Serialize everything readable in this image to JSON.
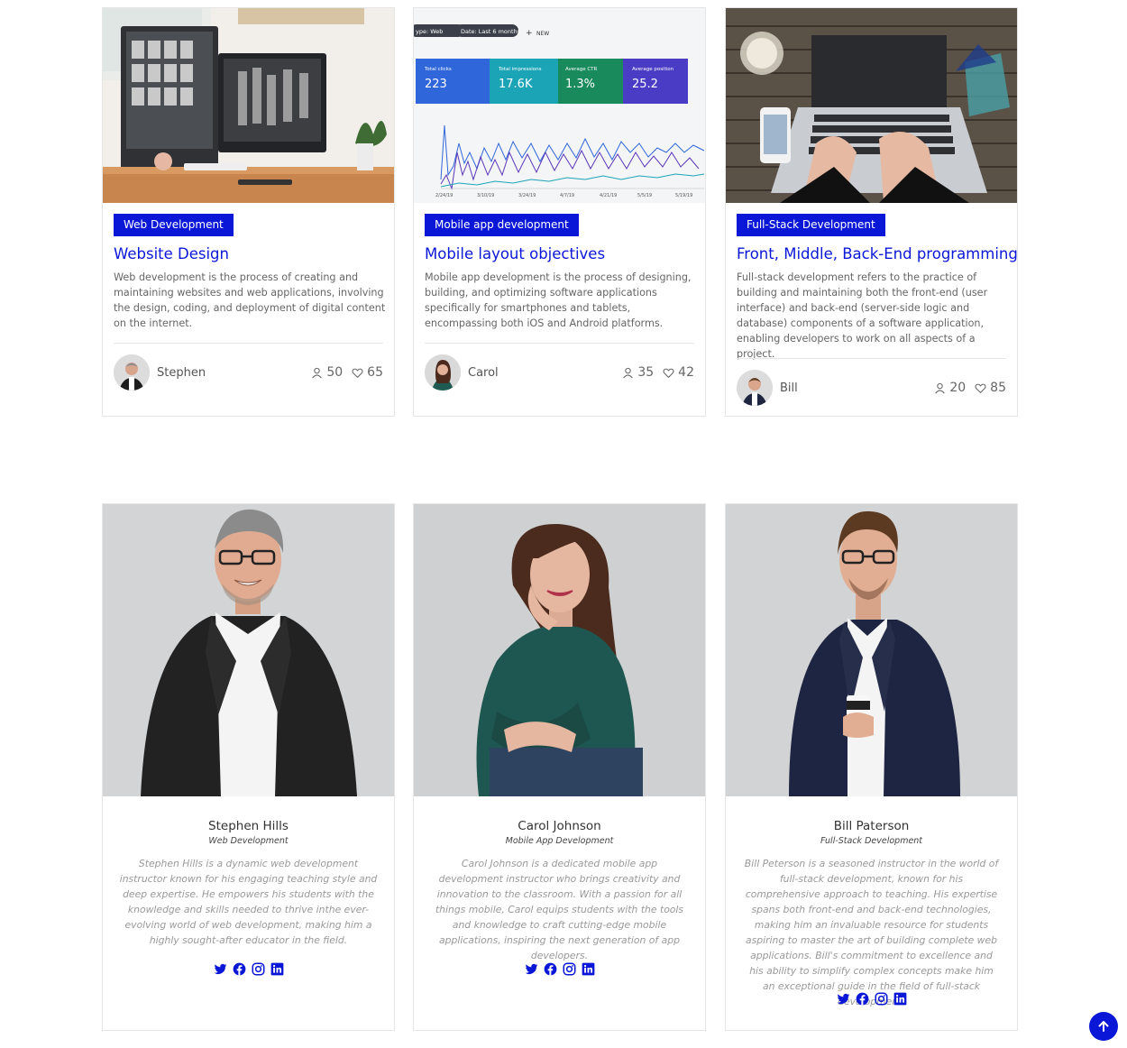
{
  "courses": [
    {
      "category": "Web Development",
      "title": "Website Design",
      "description": "Web development is the process of creating and maintaining websites and web applications, involving the design, coding, and deployment of digital content on the internet.",
      "author": "Stephen",
      "students": "50",
      "likes": "65",
      "image_icon": "desk-computers-photo"
    },
    {
      "category": "Mobile app development",
      "title": "Mobile layout objectives",
      "description": "Mobile app development is the process of designing, building, and optimizing software applications specifically for smartphones and tablets, encompassing both iOS and Android platforms.",
      "author": "Carol",
      "students": "35",
      "likes": "42",
      "image_icon": "analytics-dashboard-photo",
      "dashboard": {
        "chips": [
          "ype: Web",
          "Date: Last 6 months",
          "NEW"
        ],
        "tiles": [
          {
            "label": "Total clicks",
            "value": "223"
          },
          {
            "label": "Total impressions",
            "value": "17.6K"
          },
          {
            "label": "Average CTR",
            "value": "1.3%"
          },
          {
            "label": "Average position",
            "value": "25.2"
          }
        ],
        "dates": [
          "2/24/19",
          "3/10/19",
          "3/24/19",
          "4/7/19",
          "4/21/19",
          "5/5/19",
          "5/19/19"
        ]
      }
    },
    {
      "category": "Full-Stack Development",
      "title": "Front, Middle, Back-End programming",
      "description": "Full-stack development refers to the practice of building and maintaining both the front-end (user interface) and back-end (server-side logic and database) components of a software application, enabling developers to work on all aspects of a project.",
      "author": "Bill",
      "students": "20",
      "likes": "85",
      "image_icon": "laptop-typing-photo"
    }
  ],
  "team": [
    {
      "name": "Stephen Hills",
      "role": "Web Development",
      "bio": "Stephen Hills is a dynamic web development instructor known for his engaging teaching style and deep expertise. He empowers his students with the knowledge and skills needed to thrive inthe ever-evolving world of web development, making him a highly sought-after educator in the field."
    },
    {
      "name": "Carol Johnson",
      "role": "Mobile App Development",
      "bio": "Carol Johnson is a dedicated mobile app development instructor who brings creativity and innovation to the classroom. With a passion for all things mobile, Carol equips students with the tools and knowledge to craft cutting-edge mobile applications, inspiring the next generation of app developers."
    },
    {
      "name": "Bill Paterson",
      "role": "Full-Stack Development",
      "bio": "Bill Peterson is a seasoned instructor in the world of full-stack development, known for his comprehensive approach to teaching. His expertise spans both front-end and back-end technologies, making him an invaluable resource for students aspiring to master the art of building complete web applications. Bill's commitment to excellence and his ability to simplify complex concepts make him an exceptional guide in the field of full-stack development."
    }
  ],
  "social_icons": [
    "twitter-icon",
    "facebook-icon",
    "instagram-icon",
    "linkedin-icon"
  ],
  "colors": {
    "accent": "#0a17d6",
    "muted_text": "#999999",
    "border": "#e6e6e6"
  }
}
